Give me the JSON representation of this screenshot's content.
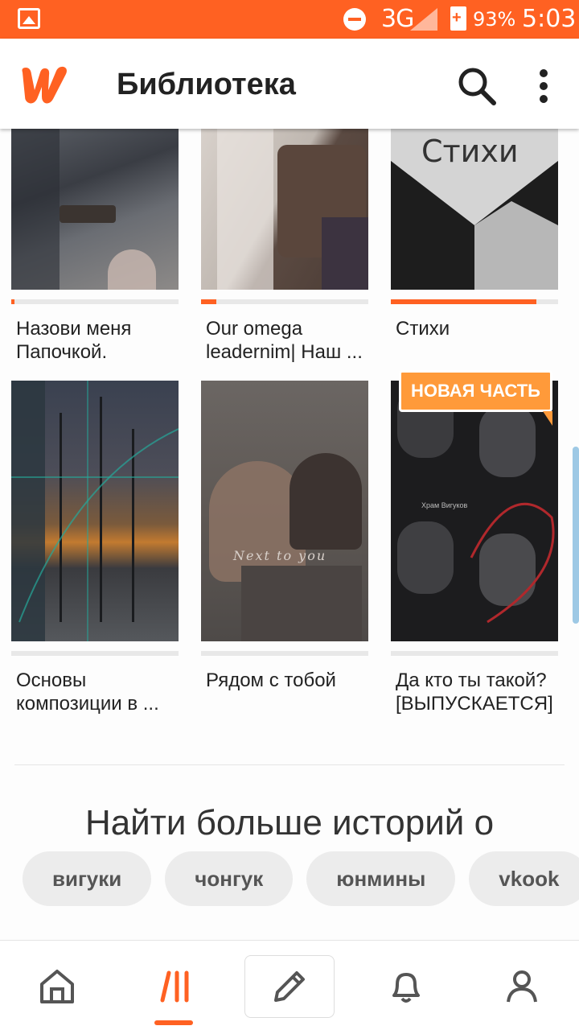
{
  "status_bar": {
    "network": "3G",
    "battery": "93%",
    "time": "5:03"
  },
  "app_bar": {
    "title": "Библиотека"
  },
  "stories": [
    {
      "title": "Назови меня Папочкой.",
      "progress": 0.02
    },
    {
      "title": "Our omega leadernim| Наш ...",
      "progress": 0.09
    },
    {
      "title": "Стихи",
      "progress": 0.87,
      "badge": "НОВАЯ ЧАСТЬ",
      "cover_text": "Стихи"
    },
    {
      "title": "Основы композиции в ...",
      "progress": 0
    },
    {
      "title": "Рядом с тобой",
      "progress": 0,
      "cover_text": "Next to you"
    },
    {
      "title": "Да кто ты такой? [ВЫПУСКАЕТСЯ]",
      "progress": 0,
      "cover_text": "Храм Вигуков"
    }
  ],
  "discover": {
    "heading": "Найти больше историй о",
    "tags": [
      "вигуки",
      "чонгук",
      "юнмины",
      "vkook"
    ]
  },
  "colors": {
    "accent": "#ff6122",
    "badge": "#ff9a3a"
  },
  "bottom_nav": [
    "home-icon",
    "library-icon",
    "write-icon",
    "notifications-icon",
    "profile-icon"
  ]
}
